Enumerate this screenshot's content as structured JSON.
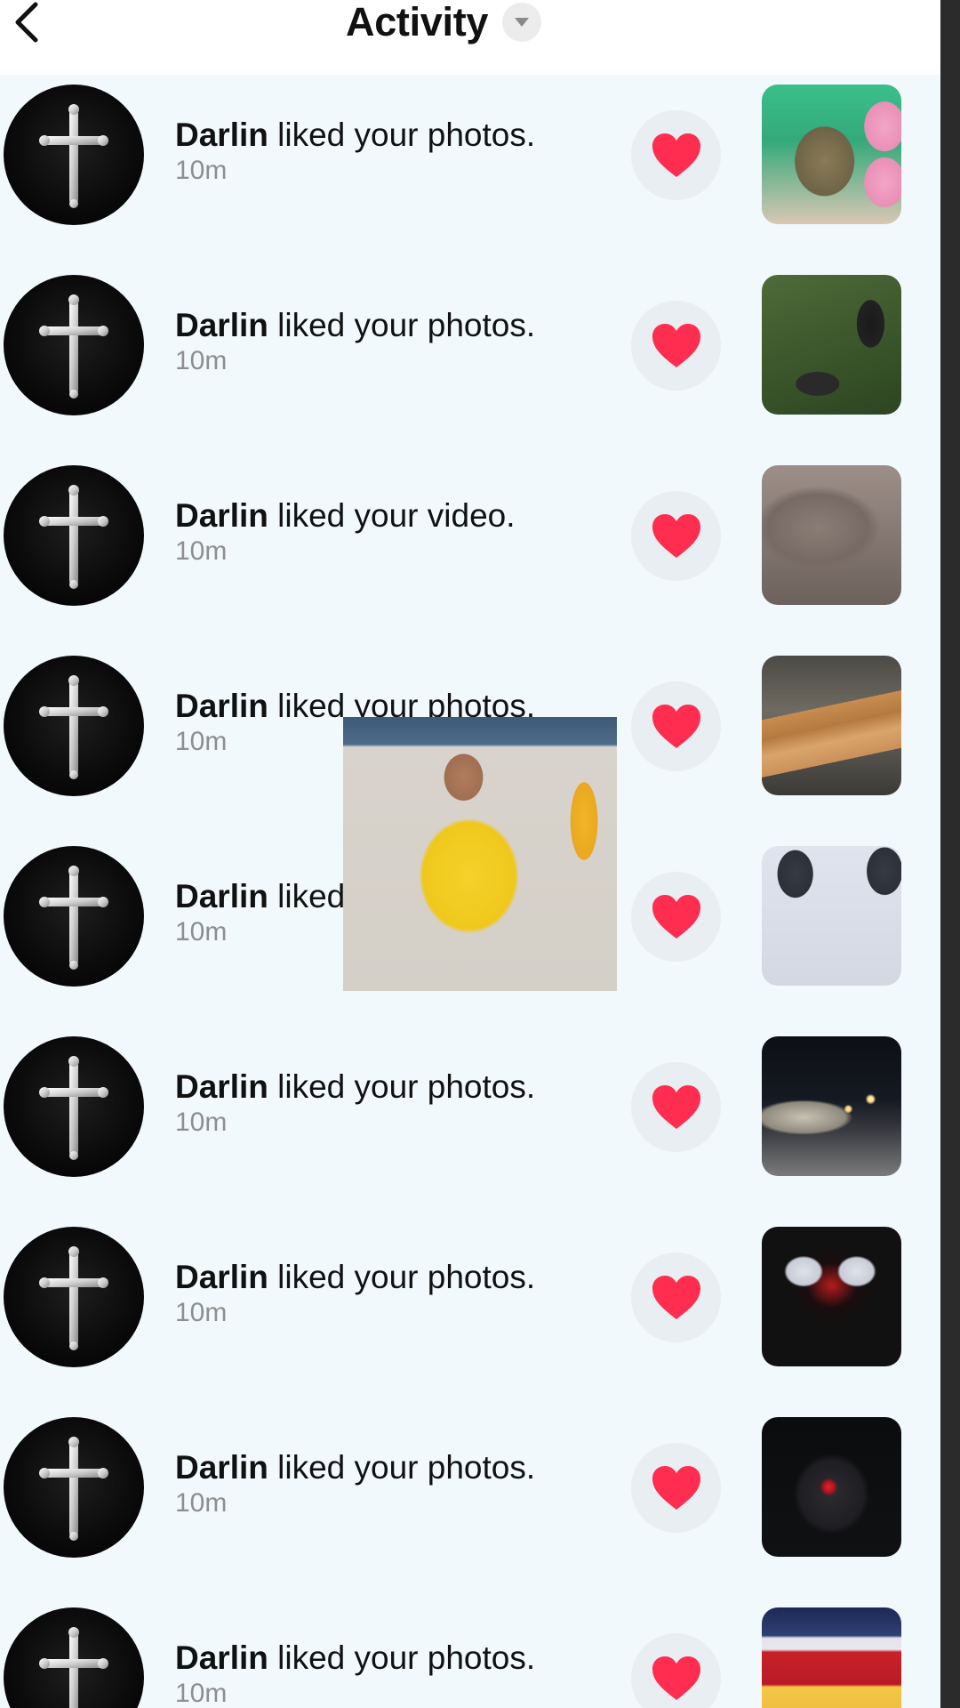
{
  "header": {
    "title": "Activity",
    "back_icon": "chevron-left-icon",
    "dropdown_icon": "caret-down-icon"
  },
  "colors": {
    "list_background": "#f1f9fd",
    "heart": "#ff2d4f",
    "like_button_bg": "#e8eef1",
    "time_text": "#8e8e8e"
  },
  "notifications": [
    {
      "username": "Darlin",
      "action": " liked your photos.",
      "time": "10m"
    },
    {
      "username": "Darlin",
      "action": " liked your photos.",
      "time": "10m"
    },
    {
      "username": "Darlin",
      "action": " liked your video.",
      "time": "10m"
    },
    {
      "username": "Darlin",
      "action": " liked your photos.",
      "time": "10m"
    },
    {
      "username": "Darlin",
      "action": " liked",
      "time": "10m"
    },
    {
      "username": "Darlin",
      "action": " liked your photos.",
      "time": "10m"
    },
    {
      "username": "Darlin",
      "action": " liked your photos.",
      "time": "10m"
    },
    {
      "username": "Darlin",
      "action": " liked your photos.",
      "time": "10m"
    },
    {
      "username": "Darlin",
      "action": " liked your photos.",
      "time": "10m"
    }
  ]
}
